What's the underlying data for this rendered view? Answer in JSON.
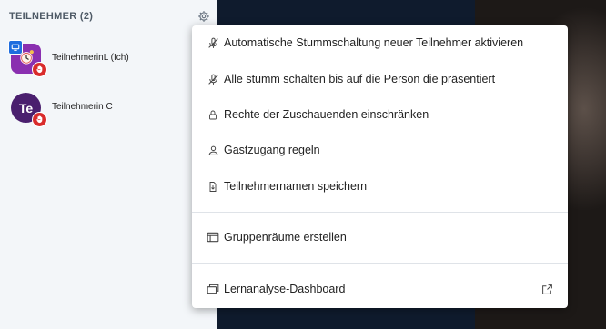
{
  "sidebar": {
    "title": "TEILNEHMER (2)",
    "settings_icon": "gear-icon",
    "participants": [
      {
        "name": "TeilnehmerinL (Ich)",
        "avatar_icon": "alarm-clock-icon",
        "avatar_color": "#8a2fb0",
        "presenter": true,
        "hand_raised": true
      },
      {
        "name": "Teilnehmerin C",
        "initials": "Te",
        "avatar_color": "#4a1f6e",
        "presenter": false,
        "hand_raised": true
      }
    ]
  },
  "menu": {
    "items": [
      {
        "label": "Automatische Stummschaltung neuer Teilnehmer aktivieren",
        "icon": "mic-muted-icon"
      },
      {
        "label": "Alle stumm schalten bis auf die Person die präsentiert",
        "icon": "mic-muted-icon"
      },
      {
        "label": "Rechte der Zuschauenden einschränken",
        "icon": "lock-icon"
      },
      {
        "label": "Gastzugang regeln",
        "icon": "user-icon"
      },
      {
        "label": "Teilnehmernamen speichern",
        "icon": "file-download-icon"
      },
      {
        "label": "Gruppenräume erstellen",
        "icon": "rooms-icon"
      },
      {
        "label": "Lernanalyse-Dashboard",
        "icon": "dashboard-icon",
        "trailing_icon": "external-link-icon"
      }
    ]
  },
  "colors": {
    "accent_red": "#d92b2b",
    "presenter_blue": "#1f6dde",
    "background_dark": "#0f1b2d",
    "sidebar_bg": "#f3f6f9"
  }
}
